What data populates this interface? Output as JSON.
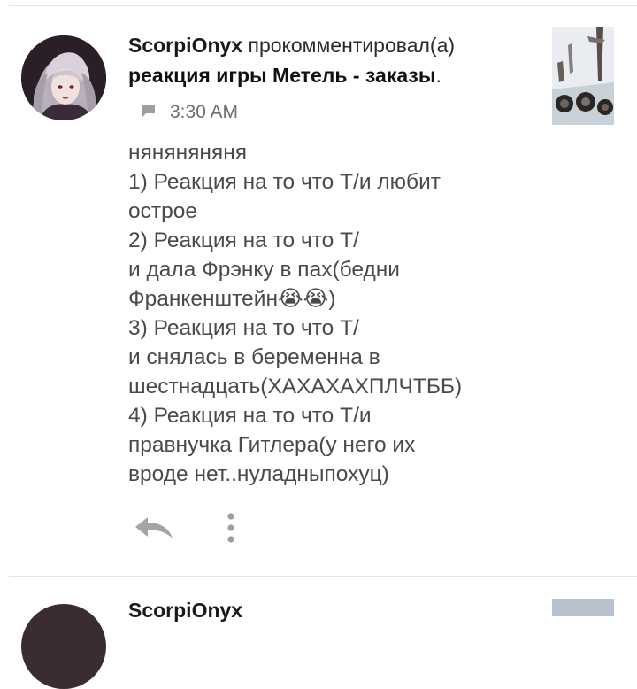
{
  "notification": {
    "username": "ScorpiOnyx",
    "action": "прокомментировал(а)",
    "post_title": "реакция игры Метель - заказы",
    "title_suffix": ".",
    "time": "3:30 AM",
    "comment_icon": "comment-icon",
    "comment_lines": [
      "няняняняня",
      "1) Реакция на то что Т/и любит",
      "острое",
      "2) Реакция на то что Т/",
      "и дала Фрэнку в пах(бедни",
      "Франкенштейн😭😭)",
      "3) Реакция на то что Т/",
      "и снялась в беременна в",
      "шестнадцать(ХАХАХАХПЛЧТББ)",
      "4) Реакция на то что Т/и",
      "правнучка Гитлера(у него их",
      "вроде нет..нуладныпохуц)"
    ],
    "reply_icon": "reply-icon",
    "more_icon": "more-vert-icon"
  },
  "next_notification": {
    "username": "ScorpiOnyx"
  },
  "colors": {
    "username": "#1a1a1a",
    "body_text": "#4a4a4a",
    "meta_text": "#6e6e6e",
    "icon_gray": "#9e9e9e",
    "divider": "#e4e4e4"
  }
}
